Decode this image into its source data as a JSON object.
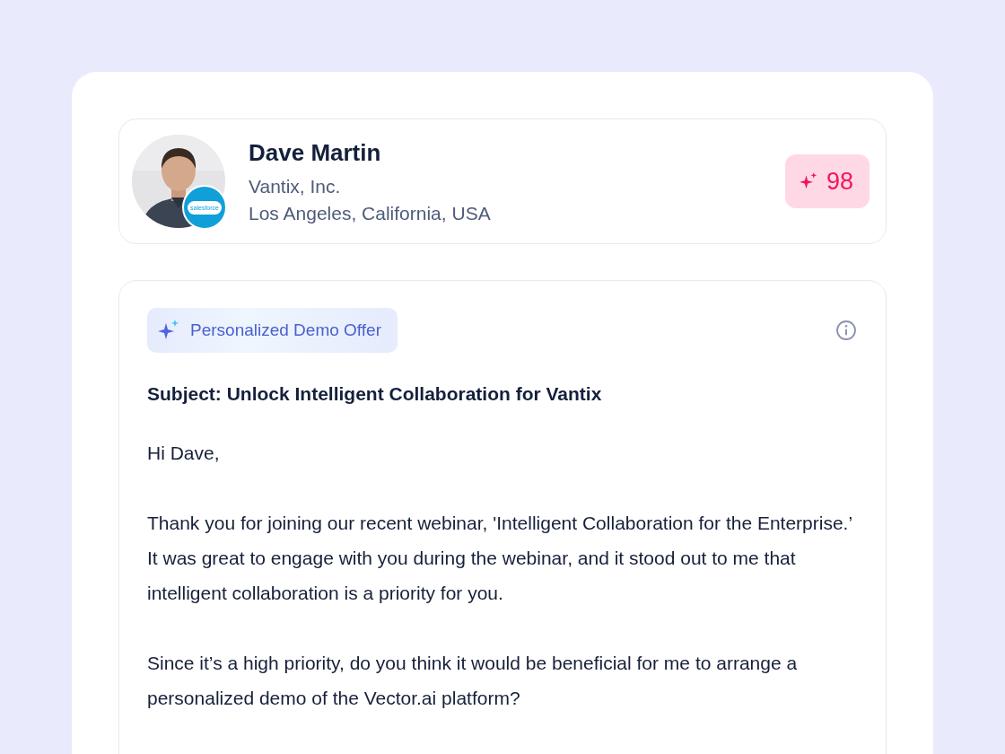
{
  "contact": {
    "name": "Dave Martin",
    "company": "Vantix, Inc.",
    "location": "Los Angeles, California, USA",
    "crm_badge": "salesforce",
    "score": "98"
  },
  "email": {
    "tag": "Personalized Demo Offer",
    "subject": "Subject: Unlock Intelligent Collaboration for Vantix",
    "greeting": "Hi Dave,",
    "paragraphs": [
      "Thank you for joining our recent webinar, 'Intelligent Collaboration for the Enterprise.’ It was great to engage with you during the webinar, and it stood out to me that intelligent collaboration is a priority for you.",
      "Since it’s a high priority, do you think it would be beneficial for me to arrange a personalized demo of the Vector.ai platform?"
    ]
  }
}
